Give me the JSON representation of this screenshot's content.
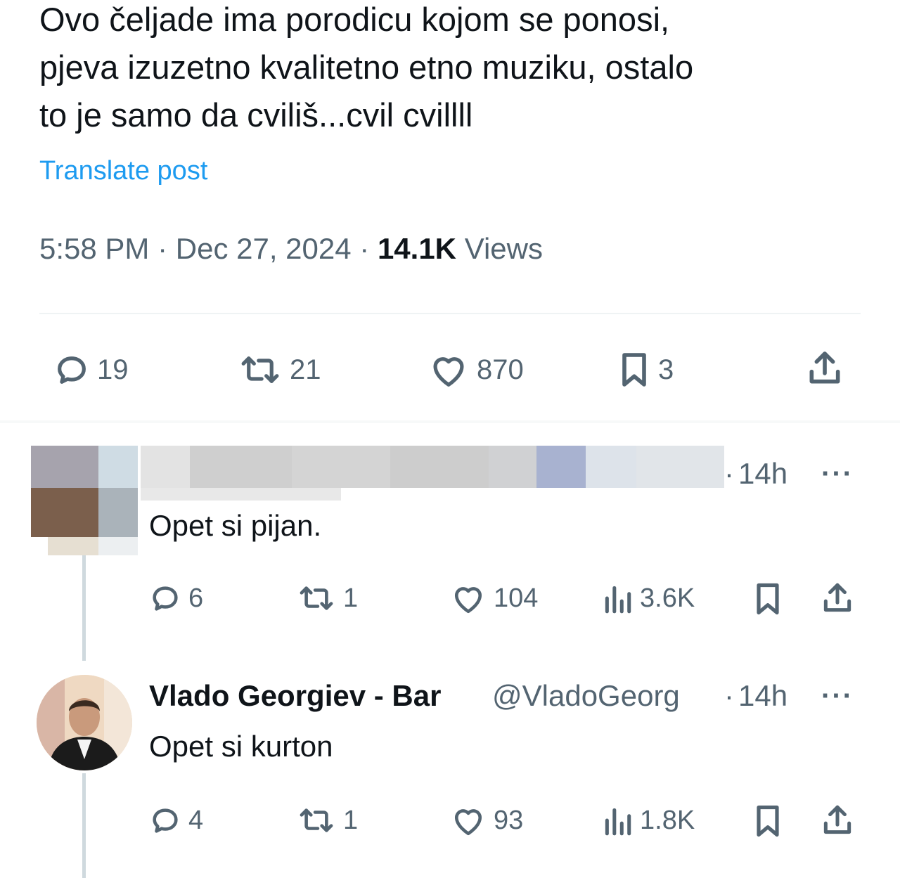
{
  "post": {
    "lines": [
      "Ovo čeljade ima porodicu kojom se ponosi,",
      "pjeva izuzetno kvalitetno etno muziku, ostalo",
      "to je samo da cviliš...cvil cvillll"
    ],
    "translate_label": "Translate post",
    "time": "5:58 PM",
    "date": "Dec 27, 2024",
    "views_count": "14.1K",
    "views_label": "Views",
    "separator": " · ",
    "actions": {
      "replies": "19",
      "reposts": "21",
      "likes": "870",
      "bookmarks": "3"
    }
  },
  "replies": [
    {
      "name_blurred": true,
      "time": "14h",
      "more": "···",
      "text": "Opet si pijan.",
      "actions": {
        "replies": "6",
        "reposts": "1",
        "likes": "104",
        "views": "3.6K"
      }
    },
    {
      "name": "Vlado Georgiev - Bar",
      "handle": "@VladoGeorg",
      "time": "14h",
      "more": "···",
      "text": "Opet si kurton",
      "actions": {
        "replies": "4",
        "reposts": "1",
        "likes": "93",
        "views": "1.8K"
      }
    }
  ],
  "icons": {
    "reply": "speech-bubble-icon",
    "repost": "repost-arrows-icon",
    "like": "heart-icon",
    "bookmark": "bookmark-icon",
    "share": "share-upload-icon",
    "views": "bar-chart-icon"
  },
  "colors": {
    "text": "#0f1419",
    "secondary": "#536471",
    "link": "#1d9bf0",
    "divider": "#eff3f4",
    "thread_line": "#cfd9de"
  }
}
